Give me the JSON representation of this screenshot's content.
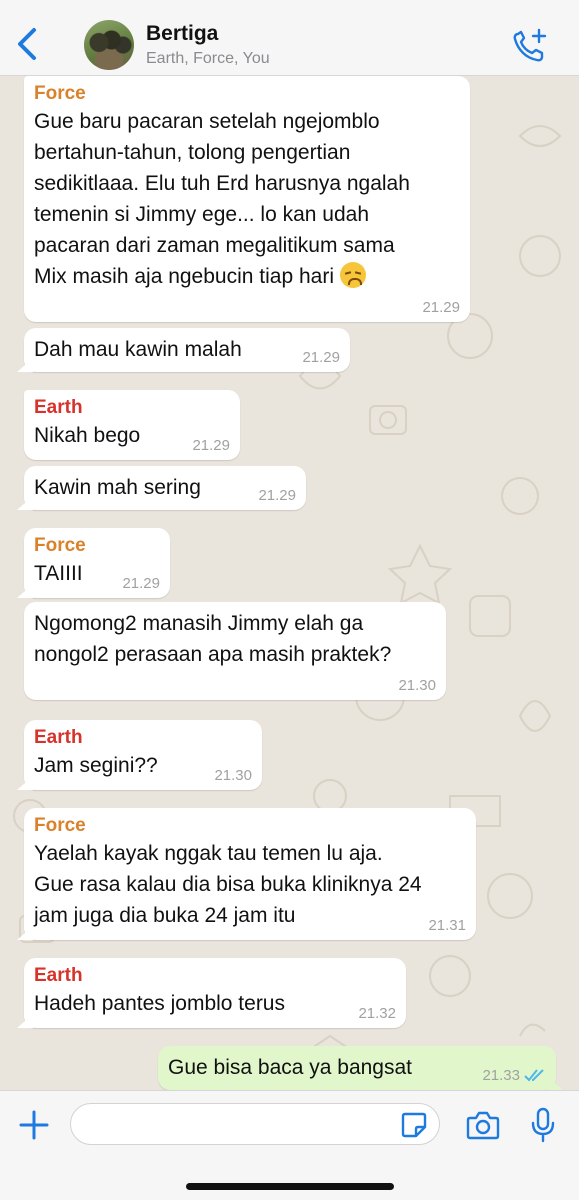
{
  "header": {
    "title": "Bertiga",
    "subtitle": "Earth, Force, You"
  },
  "icons": {
    "back": "chevron-left-icon",
    "call": "add-call-icon",
    "attach": "plus-icon",
    "sticker": "sticker-icon",
    "camera": "camera-icon",
    "mic": "microphone-icon",
    "read": "double-check-icon"
  },
  "colors": {
    "accent": "#1f7ae0",
    "force": "#d9822b",
    "earth": "#d6342b",
    "outgoing": "#e1f7cb",
    "read_ticks": "#4fb6ec"
  },
  "messages": [
    {
      "sender": "Force",
      "lines": [
        "Gue baru pacaran setelah ngejomblo",
        "bertahun-tahun, tolong pengertian",
        "sedikitlaaa. Elu tuh Erd harusnya ngalah",
        "temenin si Jimmy ege... lo kan udah",
        "pacaran dari zaman megalitikum sama",
        "Mix masih aja ngebucin tiap hari"
      ],
      "time": "21.29"
    },
    {
      "sender": "",
      "lines": [
        "Dah mau kawin malah"
      ],
      "time": "21.29"
    },
    {
      "sender": "Earth",
      "lines": [
        "Nikah bego"
      ],
      "time": "21.29"
    },
    {
      "sender": "",
      "lines": [
        "Kawin mah sering"
      ],
      "time": "21.29"
    },
    {
      "sender": "Force",
      "lines": [
        "TAIIII"
      ],
      "time": "21.29"
    },
    {
      "sender": "",
      "lines": [
        "Ngomong2 manasih Jimmy elah ga",
        "nongol2 perasaan apa masih praktek?"
      ],
      "time": "21.30"
    },
    {
      "sender": "Earth",
      "lines": [
        "Jam segini??"
      ],
      "time": "21.30"
    },
    {
      "sender": "Force",
      "lines": [
        "Yaelah kayak nggak tau temen lu aja.",
        "Gue rasa kalau dia bisa buka kliniknya 24",
        "jam juga dia buka 24 jam itu"
      ],
      "time": "21.31"
    },
    {
      "sender": "Earth",
      "lines": [
        "Hadeh pantes jomblo terus"
      ],
      "time": "21.32"
    },
    {
      "sender": "You",
      "lines": [
        "Gue bisa baca ya bangsat"
      ],
      "time": "21.33"
    }
  ]
}
